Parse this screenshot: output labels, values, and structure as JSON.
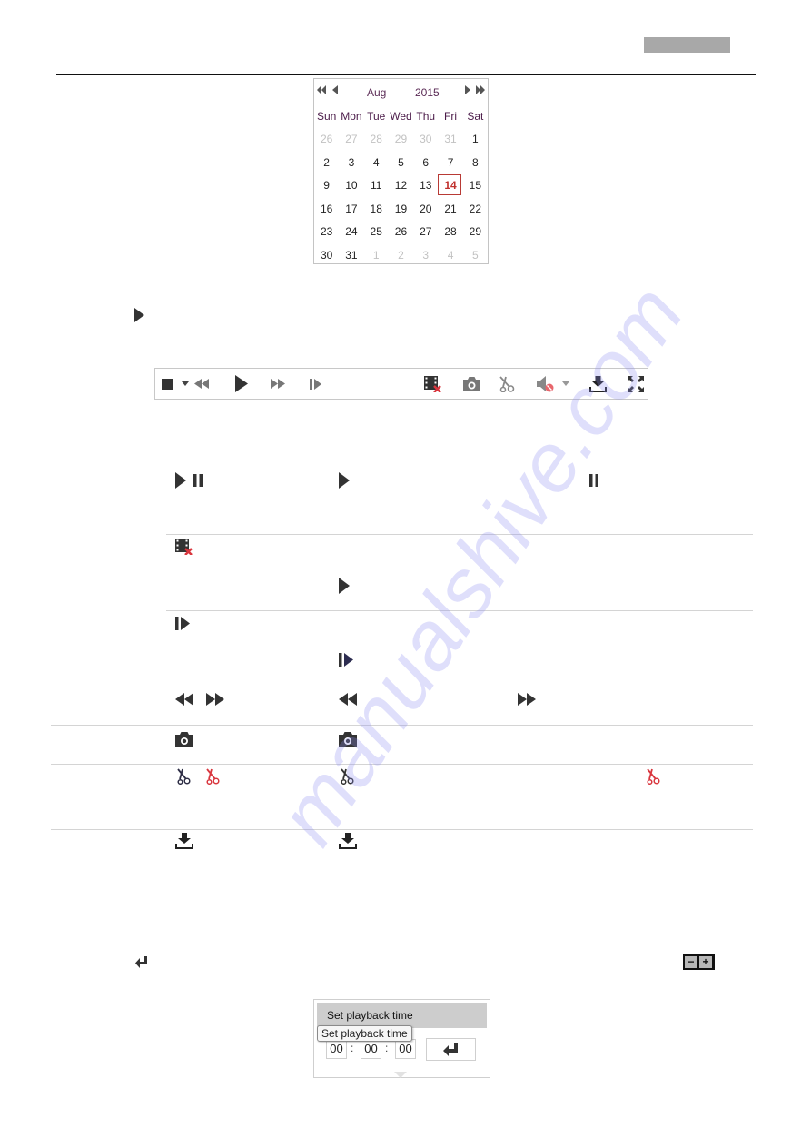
{
  "header": {
    "tab_color": "#a8a8a8"
  },
  "calendar": {
    "month": "Aug",
    "year": "2015",
    "nav": {
      "prev_year_icon": "double-left-arrow",
      "prev_month_icon": "left-arrow",
      "next_month_icon": "right-arrow",
      "next_year_icon": "double-right-arrow"
    },
    "weekdays": [
      "Sun",
      "Mon",
      "Tue",
      "Wed",
      "Thu",
      "Fri",
      "Sat"
    ],
    "weeks": [
      [
        {
          "d": "26",
          "o": true
        },
        {
          "d": "27",
          "o": true
        },
        {
          "d": "28",
          "o": true
        },
        {
          "d": "29",
          "o": true
        },
        {
          "d": "30",
          "o": true
        },
        {
          "d": "31",
          "o": true
        },
        {
          "d": "1"
        }
      ],
      [
        {
          "d": "2"
        },
        {
          "d": "3"
        },
        {
          "d": "4"
        },
        {
          "d": "5"
        },
        {
          "d": "6"
        },
        {
          "d": "7"
        },
        {
          "d": "8"
        }
      ],
      [
        {
          "d": "9"
        },
        {
          "d": "10"
        },
        {
          "d": "11"
        },
        {
          "d": "12"
        },
        {
          "d": "13"
        },
        {
          "d": "14",
          "s": true
        },
        {
          "d": "15"
        }
      ],
      [
        {
          "d": "16"
        },
        {
          "d": "17"
        },
        {
          "d": "18"
        },
        {
          "d": "19"
        },
        {
          "d": "20"
        },
        {
          "d": "21"
        },
        {
          "d": "22"
        }
      ],
      [
        {
          "d": "23"
        },
        {
          "d": "24"
        },
        {
          "d": "25"
        },
        {
          "d": "26"
        },
        {
          "d": "27"
        },
        {
          "d": "28"
        },
        {
          "d": "29"
        }
      ],
      [
        {
          "d": "30"
        },
        {
          "d": "31"
        },
        {
          "d": "1",
          "o": true
        },
        {
          "d": "2",
          "o": true
        },
        {
          "d": "3",
          "o": true
        },
        {
          "d": "4",
          "o": true
        },
        {
          "d": "5",
          "o": true
        }
      ]
    ],
    "selected_day": "14",
    "selected_color": "#c0312d",
    "weekday_color": "#4a1a48"
  },
  "toolbar": {
    "buttons": [
      "stop",
      "speed-dropdown",
      "slow-forward",
      "play",
      "fast-forward",
      "single-frame",
      "stop-all-playback",
      "capture",
      "clip",
      "audio-off",
      "audio-dropdown",
      "download",
      "fullscreen"
    ]
  },
  "table": {
    "rows": [
      {
        "icons": [
          "play",
          "pause"
        ],
        "desc_icons": [
          "play",
          "pause"
        ]
      },
      {
        "icons": [
          "stop-all-playback"
        ],
        "desc_icons": [
          "play"
        ]
      },
      {
        "icons": [
          "single-frame"
        ],
        "desc_icons": [
          "single-frame"
        ]
      },
      {
        "icons": [
          "slow-forward",
          "fast-forward"
        ],
        "desc_icons": [
          "slow-forward",
          "fast-forward"
        ]
      },
      {
        "icons": [
          "capture"
        ],
        "desc_icons": [
          "capture"
        ]
      },
      {
        "icons": [
          "clip-off",
          "clip-on"
        ],
        "desc_icons": [
          "clip-off",
          "clip-on"
        ]
      },
      {
        "icons": [
          "download"
        ],
        "desc_icons": [
          "download"
        ]
      }
    ]
  },
  "playback_time": {
    "title": "Set playback time",
    "tooltip": "Set playback time",
    "hours": "00",
    "minutes": "00",
    "seconds": "00",
    "separator": ":"
  },
  "zoom_buttons": {
    "minus": "−",
    "plus": "+"
  },
  "watermark": "manualshive.com",
  "colors": {
    "icon_dark": "#333333",
    "icon_gray": "#7a7a7a",
    "accent_red": "#d9363e",
    "watermark": "#8c8cf0"
  }
}
